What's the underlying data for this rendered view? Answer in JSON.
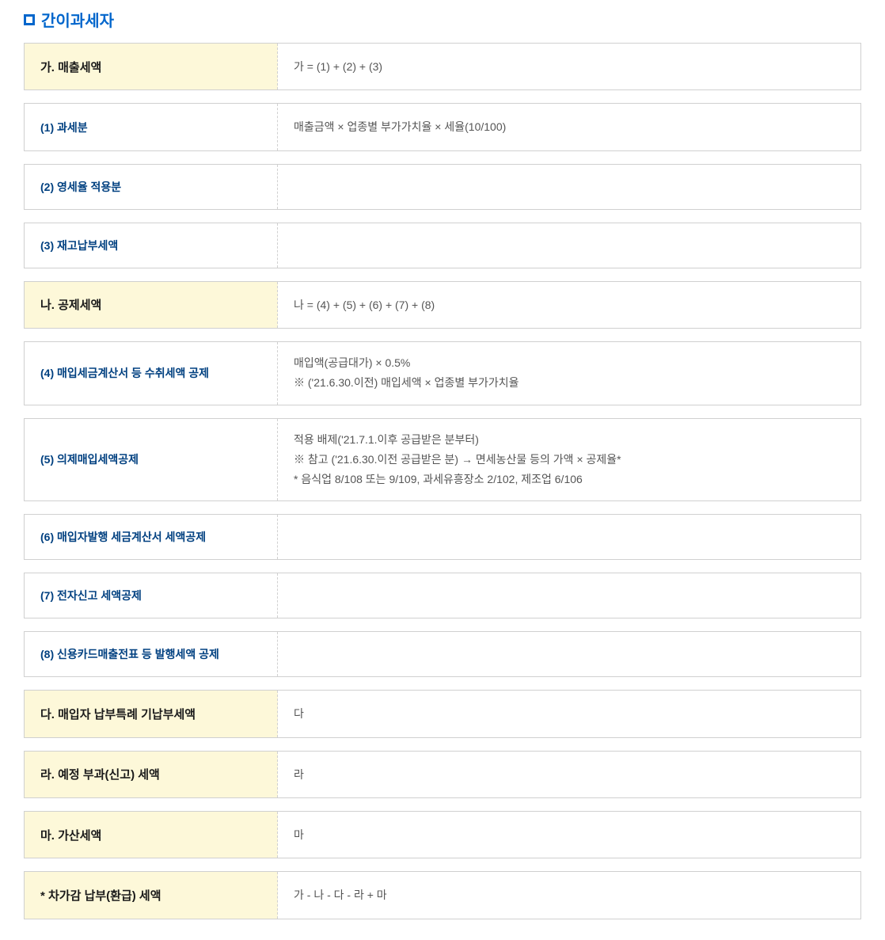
{
  "title": "간이과세자",
  "rows": {
    "ga": {
      "label": "가. 매출세액",
      "value": "가 = (1) + (2) + (3)"
    },
    "item1": {
      "label": "(1) 과세분",
      "value": "매출금액 × 업종별 부가가치율 × 세율(10/100)"
    },
    "item2": {
      "label": "(2) 영세율 적용분",
      "value": ""
    },
    "item3": {
      "label": "(3) 재고납부세액",
      "value": ""
    },
    "na": {
      "label": "나. 공제세액",
      "value": "나 = (4) + (5) + (6) + (7) + (8)"
    },
    "item4": {
      "label": "(4) 매입세금계산서 등 수취세액 공제",
      "line1": "매입액(공급대가) × 0.5%",
      "line2": "※ ('21.6.30.이전) 매입세액 × 업종별 부가가치율"
    },
    "item5": {
      "label": "(5) 의제매입세액공제",
      "line1": "적용 배제('21.7.1.이후 공급받은 분부터)",
      "line2": "※ 참고 ('21.6.30.이전 공급받은 분) → 면세농산물 등의 가액 × 공제율*",
      "line3": "* 음식업 8/108 또는 9/109, 과세유흥장소 2/102, 제조업 6/106"
    },
    "item6": {
      "label": "(6) 매입자발행 세금계산서 세액공제",
      "value": ""
    },
    "item7": {
      "label": "(7) 전자신고 세액공제",
      "value": ""
    },
    "item8": {
      "label": "(8) 신용카드매출전표 등 발행세액 공제",
      "value": ""
    },
    "da": {
      "label": "다. 매입자 납부특례 기납부세액",
      "value": "다"
    },
    "ra": {
      "label": "라. 예정 부과(신고) 세액",
      "value": "라"
    },
    "ma": {
      "label": "마. 가산세액",
      "value": "마"
    },
    "final": {
      "label": "* 차가감 납부(환급) 세액",
      "value": "가 - 나 - 다 - 라 + 마"
    }
  }
}
